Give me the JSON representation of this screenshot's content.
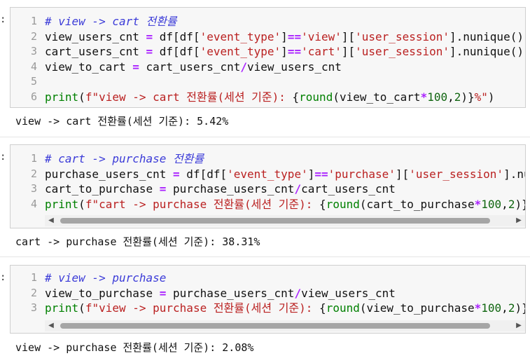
{
  "prompt_mark": ":",
  "cells": [
    {
      "lines": [
        {
          "no": "1",
          "segments": [
            {
              "cls": "cm",
              "text": "# view -> cart 전환률"
            }
          ]
        },
        {
          "no": "2",
          "segments": [
            {
              "cls": "",
              "text": "view_users_cnt "
            },
            {
              "cls": "op",
              "text": "="
            },
            {
              "cls": "",
              "text": " df[df["
            },
            {
              "cls": "st",
              "text": "'event_type'"
            },
            {
              "cls": "",
              "text": "]"
            },
            {
              "cls": "op",
              "text": "=="
            },
            {
              "cls": "st",
              "text": "'view'"
            },
            {
              "cls": "",
              "text": "]["
            },
            {
              "cls": "st",
              "text": "'user_session'"
            },
            {
              "cls": "",
              "text": "].nunique()"
            }
          ]
        },
        {
          "no": "3",
          "segments": [
            {
              "cls": "",
              "text": "cart_users_cnt "
            },
            {
              "cls": "op",
              "text": "="
            },
            {
              "cls": "",
              "text": " df[df["
            },
            {
              "cls": "st",
              "text": "'event_type'"
            },
            {
              "cls": "",
              "text": "]"
            },
            {
              "cls": "op",
              "text": "=="
            },
            {
              "cls": "st",
              "text": "'cart'"
            },
            {
              "cls": "",
              "text": "]["
            },
            {
              "cls": "st",
              "text": "'user_session'"
            },
            {
              "cls": "",
              "text": "].nunique()"
            }
          ]
        },
        {
          "no": "4",
          "segments": [
            {
              "cls": "",
              "text": "view_to_cart "
            },
            {
              "cls": "op",
              "text": "="
            },
            {
              "cls": "",
              "text": " cart_users_cnt"
            },
            {
              "cls": "op",
              "text": "/"
            },
            {
              "cls": "",
              "text": "view_users_cnt"
            }
          ]
        },
        {
          "no": "5",
          "segments": []
        },
        {
          "no": "6",
          "segments": [
            {
              "cls": "bi",
              "text": "print"
            },
            {
              "cls": "",
              "text": "("
            },
            {
              "cls": "st",
              "text": "f\"view -> cart 전환률(세션 기준): "
            },
            {
              "cls": "",
              "text": "{"
            },
            {
              "cls": "bi",
              "text": "round"
            },
            {
              "cls": "",
              "text": "(view_to_cart"
            },
            {
              "cls": "op",
              "text": "*"
            },
            {
              "cls": "nm",
              "text": "100"
            },
            {
              "cls": "",
              "text": ","
            },
            {
              "cls": "nm",
              "text": "2"
            },
            {
              "cls": "",
              "text": ")}"
            },
            {
              "cls": "st",
              "text": "%\""
            },
            {
              "cls": "",
              "text": ")"
            }
          ]
        }
      ],
      "output": "view -> cart 전환률(세션 기준): 5.42%"
    },
    {
      "lines": [
        {
          "no": "1",
          "segments": [
            {
              "cls": "cm",
              "text": "# cart -> purchase 전환률"
            }
          ]
        },
        {
          "no": "2",
          "segments": [
            {
              "cls": "",
              "text": "purchase_users_cnt "
            },
            {
              "cls": "op",
              "text": "="
            },
            {
              "cls": "",
              "text": " df[df["
            },
            {
              "cls": "st",
              "text": "'event_type'"
            },
            {
              "cls": "",
              "text": "]"
            },
            {
              "cls": "op",
              "text": "=="
            },
            {
              "cls": "st",
              "text": "'purchase'"
            },
            {
              "cls": "",
              "text": "]["
            },
            {
              "cls": "st",
              "text": "'user_session'"
            },
            {
              "cls": "",
              "text": "].nuniqu"
            }
          ]
        },
        {
          "no": "3",
          "segments": [
            {
              "cls": "",
              "text": "cart_to_purchase "
            },
            {
              "cls": "op",
              "text": "="
            },
            {
              "cls": "",
              "text": " purchase_users_cnt"
            },
            {
              "cls": "op",
              "text": "/"
            },
            {
              "cls": "",
              "text": "cart_users_cnt"
            }
          ]
        },
        {
          "no": "4",
          "segments": [
            {
              "cls": "bi",
              "text": "print"
            },
            {
              "cls": "",
              "text": "("
            },
            {
              "cls": "st",
              "text": "f\"cart -> purchase 전환률(세션 기준): "
            },
            {
              "cls": "",
              "text": "{"
            },
            {
              "cls": "bi",
              "text": "round"
            },
            {
              "cls": "",
              "text": "(cart_to_purchase"
            },
            {
              "cls": "op",
              "text": "*"
            },
            {
              "cls": "nm",
              "text": "100"
            },
            {
              "cls": "",
              "text": ","
            },
            {
              "cls": "nm",
              "text": "2"
            },
            {
              "cls": "",
              "text": ")}%"
            }
          ]
        }
      ],
      "output": "cart -> purchase 전환률(세션 기준): 38.31%"
    },
    {
      "lines": [
        {
          "no": "1",
          "segments": [
            {
              "cls": "cm",
              "text": "# view -> purchase"
            }
          ]
        },
        {
          "no": "2",
          "segments": [
            {
              "cls": "",
              "text": "view_to_purchase "
            },
            {
              "cls": "op",
              "text": "="
            },
            {
              "cls": "",
              "text": " purchase_users_cnt"
            },
            {
              "cls": "op",
              "text": "/"
            },
            {
              "cls": "",
              "text": "view_users_cnt"
            }
          ]
        },
        {
          "no": "3",
          "segments": [
            {
              "cls": "bi",
              "text": "print"
            },
            {
              "cls": "",
              "text": "("
            },
            {
              "cls": "st",
              "text": "f\"view -> purchase 전환률(세션 기준): "
            },
            {
              "cls": "",
              "text": "{"
            },
            {
              "cls": "bi",
              "text": "round"
            },
            {
              "cls": "",
              "text": "(view_to_purchase"
            },
            {
              "cls": "op",
              "text": "*"
            },
            {
              "cls": "nm",
              "text": "100"
            },
            {
              "cls": "",
              "text": ","
            },
            {
              "cls": "nm",
              "text": "2"
            },
            {
              "cls": "",
              "text": ")}%"
            }
          ]
        }
      ],
      "output": "view -> purchase 전환률(세션 기준): 2.08%"
    }
  ],
  "scrollbar": {
    "left_arrow": "◀",
    "right_arrow": "▶"
  }
}
